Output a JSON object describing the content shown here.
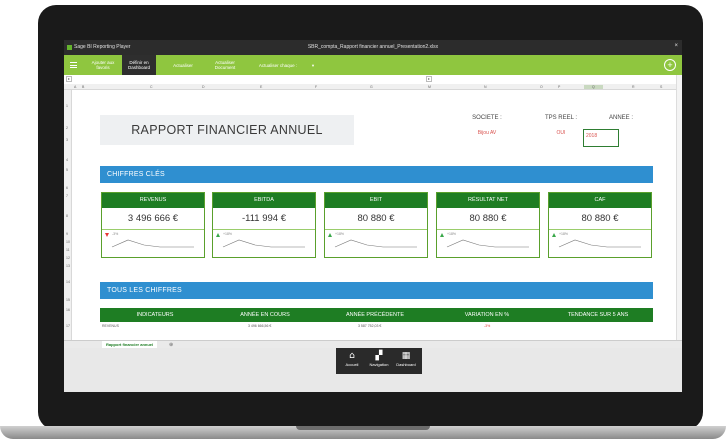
{
  "window": {
    "app_name": "Sage BI Reporting Player",
    "document": "SBR_compta_Rapport financier annuel_Presentation2.xlsx",
    "close": "×"
  },
  "toolbar": {
    "items": [
      "Ajouter aux favoris",
      "Définir en Dashboard",
      "Actualiser",
      "Actualiser Document",
      "Actualiser chaque :"
    ],
    "dropdown": "▾",
    "add": "+"
  },
  "grid": {
    "columns": [
      "A",
      "B",
      "C",
      "D",
      "E",
      "F",
      "G",
      "M",
      "N",
      "O",
      "P",
      "Q",
      "R",
      "S"
    ],
    "rows": [
      "1",
      "2",
      "3",
      "4",
      "5",
      "6",
      "7",
      "8",
      "9",
      "10",
      "11",
      "12",
      "13",
      "14",
      "15",
      "16",
      "17"
    ],
    "cell_ref": "Q",
    "mini": "▸"
  },
  "report": {
    "title": "RAPPORT FINANCIER ANNUEL",
    "societe_label": "SOCIETE :",
    "societe_value": "Bijou AV",
    "tps_label": "TPS REEL :",
    "tps_value": "OUI",
    "annee_label": "ANNEE :",
    "annee_value": "2018"
  },
  "sections": {
    "chiffres_cles": "CHIFFRES CLÉS",
    "tous_chiffres": "TOUS LES CHIFFRES"
  },
  "kpis": [
    {
      "label": "REVENUS",
      "value": "3 496 666 €",
      "trend": "down",
      "pct": "-3%"
    },
    {
      "label": "EBITDA",
      "value": "-111 994 €",
      "trend": "up",
      "pct": "+18%"
    },
    {
      "label": "EBIT",
      "value": "80 880 €",
      "trend": "up",
      "pct": "+18%"
    },
    {
      "label": "RÉSULTAT NET",
      "value": "80 880 €",
      "trend": "up",
      "pct": "+18%"
    },
    {
      "label": "CAF",
      "value": "80 880 €",
      "trend": "up",
      "pct": "+18%"
    }
  ],
  "table": {
    "headers": [
      "INDICATEURS",
      "ANNÉE EN COURS",
      "ANNÉE PRÉCÉDENTE",
      "VARIATION EN %",
      "TENDANCE SUR 5 ANS"
    ],
    "row": [
      "REVENUS",
      "3 496 666,56 €",
      "3 587 752,03 €",
      "-3%"
    ]
  },
  "sheet_tab": "Rapport financier annuel",
  "tab_add": "⊕",
  "bottom_nav": [
    {
      "label": "Accueil",
      "icon": "home-icon",
      "glyph": "⌂"
    },
    {
      "label": "Navigation",
      "icon": "map-icon",
      "glyph": "▞"
    },
    {
      "label": "Dashboard",
      "icon": "dashboard-icon",
      "glyph": "▦"
    }
  ]
}
